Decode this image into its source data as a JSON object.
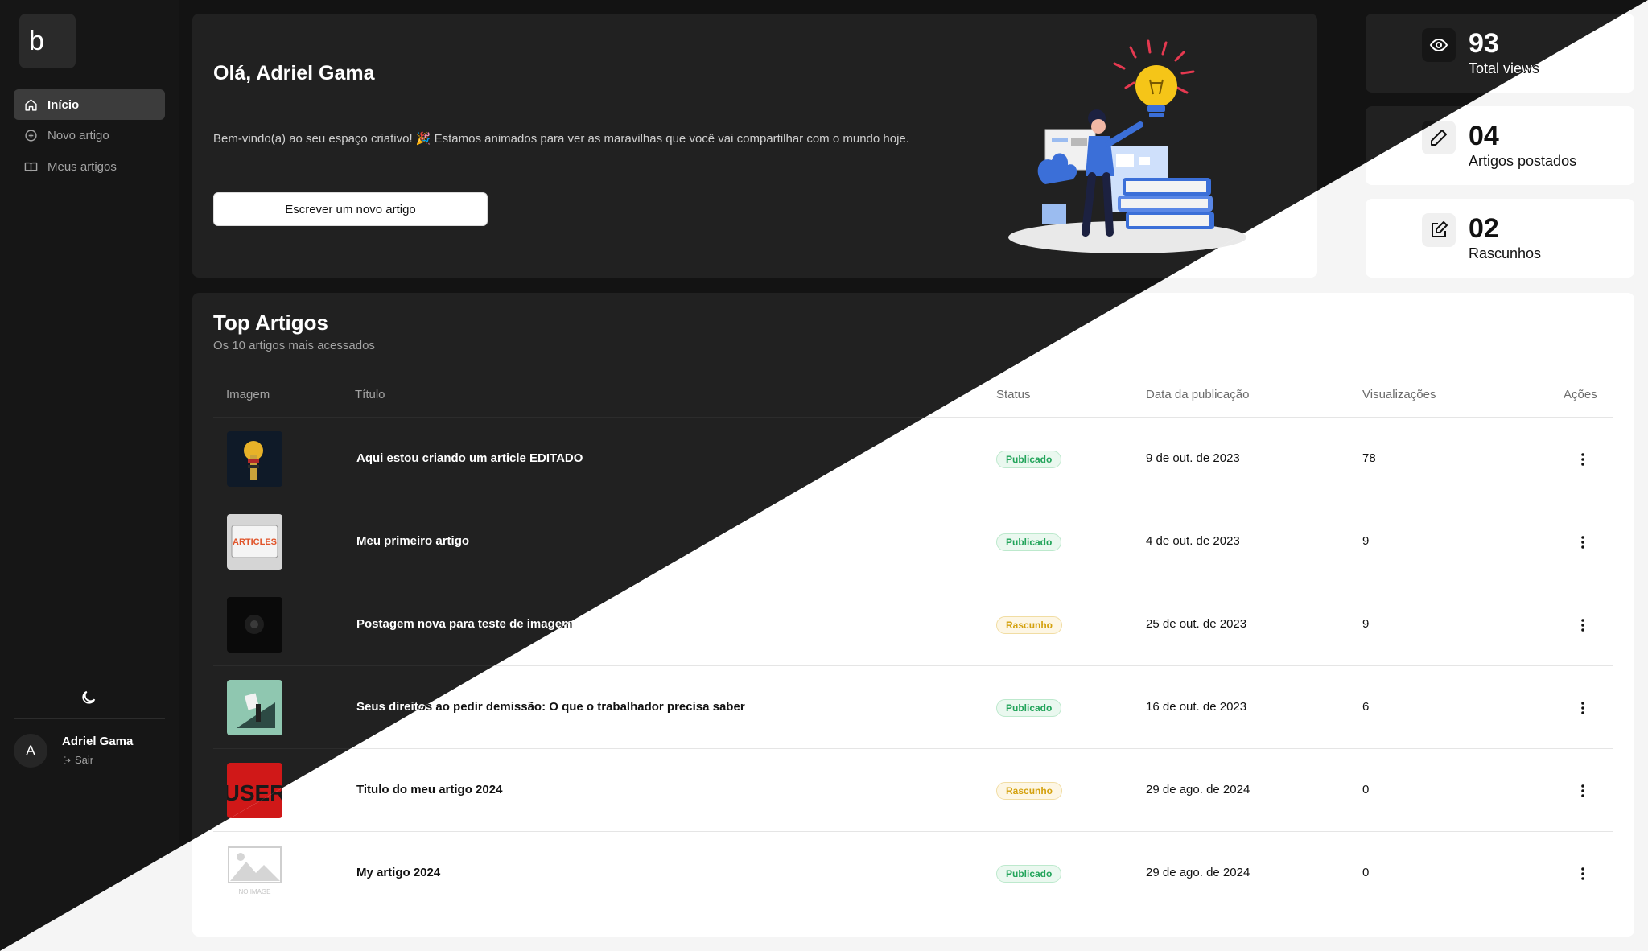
{
  "sidebar": {
    "logo": "b",
    "items": [
      {
        "label": "Início"
      },
      {
        "label": "Novo artigo"
      },
      {
        "label": "Meus artigos"
      }
    ]
  },
  "user": {
    "initial": "A",
    "name": "Adriel Gama",
    "signout": "Sair"
  },
  "hero": {
    "greeting": "Olá, Adriel Gama",
    "message": "Bem-vindo(a) ao seu espaço criativo! 🎉 Estamos animados para ver as maravilhas que você vai compartilhar com o mundo hoje.",
    "cta_label": "Escrever um novo artigo"
  },
  "stats": [
    {
      "value": "93",
      "label": "Total views",
      "icon": "eye-icon"
    },
    {
      "value": "04",
      "label": "Artigos postados",
      "icon": "pencil-icon"
    },
    {
      "value": "02",
      "label": "Rascunhos",
      "icon": "edit-square-icon"
    }
  ],
  "top_articles": {
    "title": "Top Artigos",
    "subtitle": "Os 10 artigos mais acessados",
    "columns": {
      "image": "Imagem",
      "title": "Título",
      "status": "Status",
      "date": "Data da publicação",
      "views": "Visualizações",
      "actions": "Ações"
    },
    "rows": [
      {
        "title": "Aqui estou criando um article EDITADO",
        "status": "Publicado",
        "date": "9 de out. de 2023",
        "views": "78"
      },
      {
        "title": "Meu primeiro artigo",
        "status": "Publicado",
        "date": "4 de out. de 2023",
        "views": "9"
      },
      {
        "title": "Postagem nova para teste de imagem",
        "status": "Rascunho",
        "date": "25 de out. de 2023",
        "views": "9"
      },
      {
        "title": "Seus direitos ao pedir demissão: O que o trabalhador precisa saber",
        "status": "Publicado",
        "date": "16 de out. de 2023",
        "views": "6"
      },
      {
        "title": "Titulo do meu artigo 2024",
        "status": "Rascunho",
        "date": "29 de ago. de 2024",
        "views": "0"
      },
      {
        "title": "My artigo 2024",
        "status": "Publicado",
        "date": "29 de ago. de 2024",
        "views": "0"
      }
    ],
    "thumb_texts": {
      "articles": "ARTICLES",
      "user": "USER",
      "no_image": "NO IMAGE"
    }
  },
  "colors": {
    "published": "#22a45a",
    "draft": "#d4a10e",
    "accent_bulb": "#f5c518"
  }
}
